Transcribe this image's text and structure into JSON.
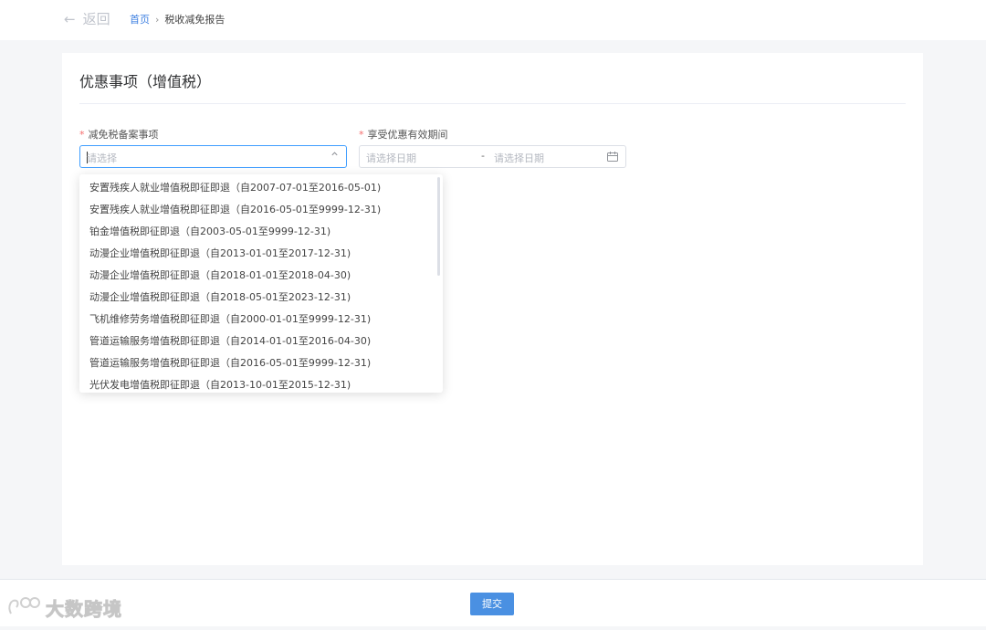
{
  "header": {
    "back_label": "返回",
    "breadcrumb": {
      "home": "首页",
      "separator": "›",
      "current": "税收减免报告"
    }
  },
  "form": {
    "title": "优惠事项（增值税）",
    "field1": {
      "required_mark": "*",
      "label": "减免税备案事项",
      "placeholder": "请选择"
    },
    "field2": {
      "required_mark": "*",
      "label": "享受优惠有效期间",
      "start_placeholder": "请选择日期",
      "separator": "-",
      "end_placeholder": "请选择日期"
    }
  },
  "dropdown": {
    "options": [
      "安置残疾人就业增值税即征即退（自2007-07-01至2016-05-01)",
      "安置残疾人就业增值税即征即退（自2016-05-01至9999-12-31)",
      "铂金增值税即征即退（自2003-05-01至9999-12-31)",
      "动漫企业增值税即征即退（自2013-01-01至2017-12-31)",
      "动漫企业增值税即征即退（自2018-01-01至2018-04-30)",
      "动漫企业增值税即征即退（自2018-05-01至2023-12-31)",
      "飞机维修劳务增值税即征即退（自2000-01-01至9999-12-31)",
      "管道运输服务增值税即征即退（自2014-01-01至2016-04-30)",
      "管道运输服务增值税即征即退（自2016-05-01至9999-12-31)",
      "光伏发电增值税即征即退（自2013-10-01至2015-12-31)"
    ]
  },
  "footer": {
    "submit_label": "提交"
  },
  "watermark": {
    "text": "大数跨境"
  },
  "colors": {
    "primary": "#409eff",
    "submit": "#4a90e2",
    "required": "#f56c6c"
  }
}
